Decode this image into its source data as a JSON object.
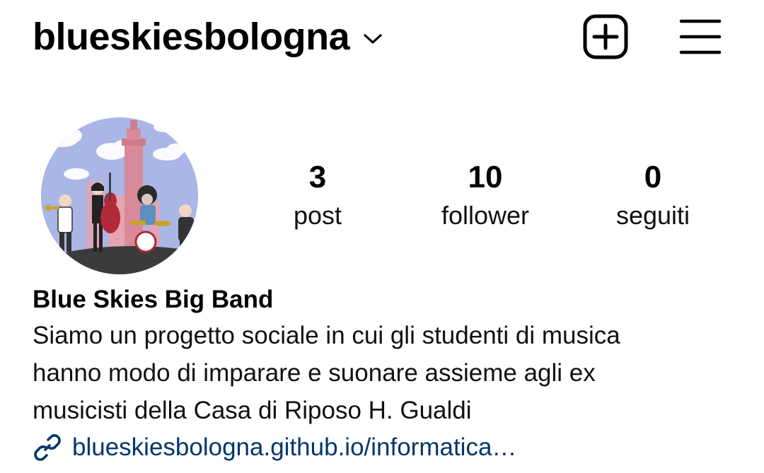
{
  "header": {
    "username": "blueskiesbologna",
    "switch_account_icon": "chevron-down-icon",
    "create_icon": "plus-square-icon",
    "menu_icon": "hamburger-menu-icon"
  },
  "profile": {
    "avatar_icon": "band-illustration-avatar",
    "stats": {
      "posts": {
        "count": "3",
        "label": "post"
      },
      "followers": {
        "count": "10",
        "label": "follower"
      },
      "following": {
        "count": "0",
        "label": "seguiti"
      }
    },
    "display_name": "Blue Skies Big Band",
    "bio_lines": [
      "Siamo un progetto sociale in cui gli studenti di musica",
      "hanno modo di imparare e suonare assieme agli ex",
      "musicisti della Casa di Riposo H. Gualdi"
    ],
    "link_icon": "link-icon",
    "link_text": "blueskiesbologna.github.io/informatica…"
  },
  "colors": {
    "text": "#000000",
    "link": "#00376b",
    "background": "#ffffff",
    "avatar_sky": "#a9b6e6",
    "avatar_tower": "#d98a9a",
    "avatar_ground": "#3b3b3b"
  }
}
